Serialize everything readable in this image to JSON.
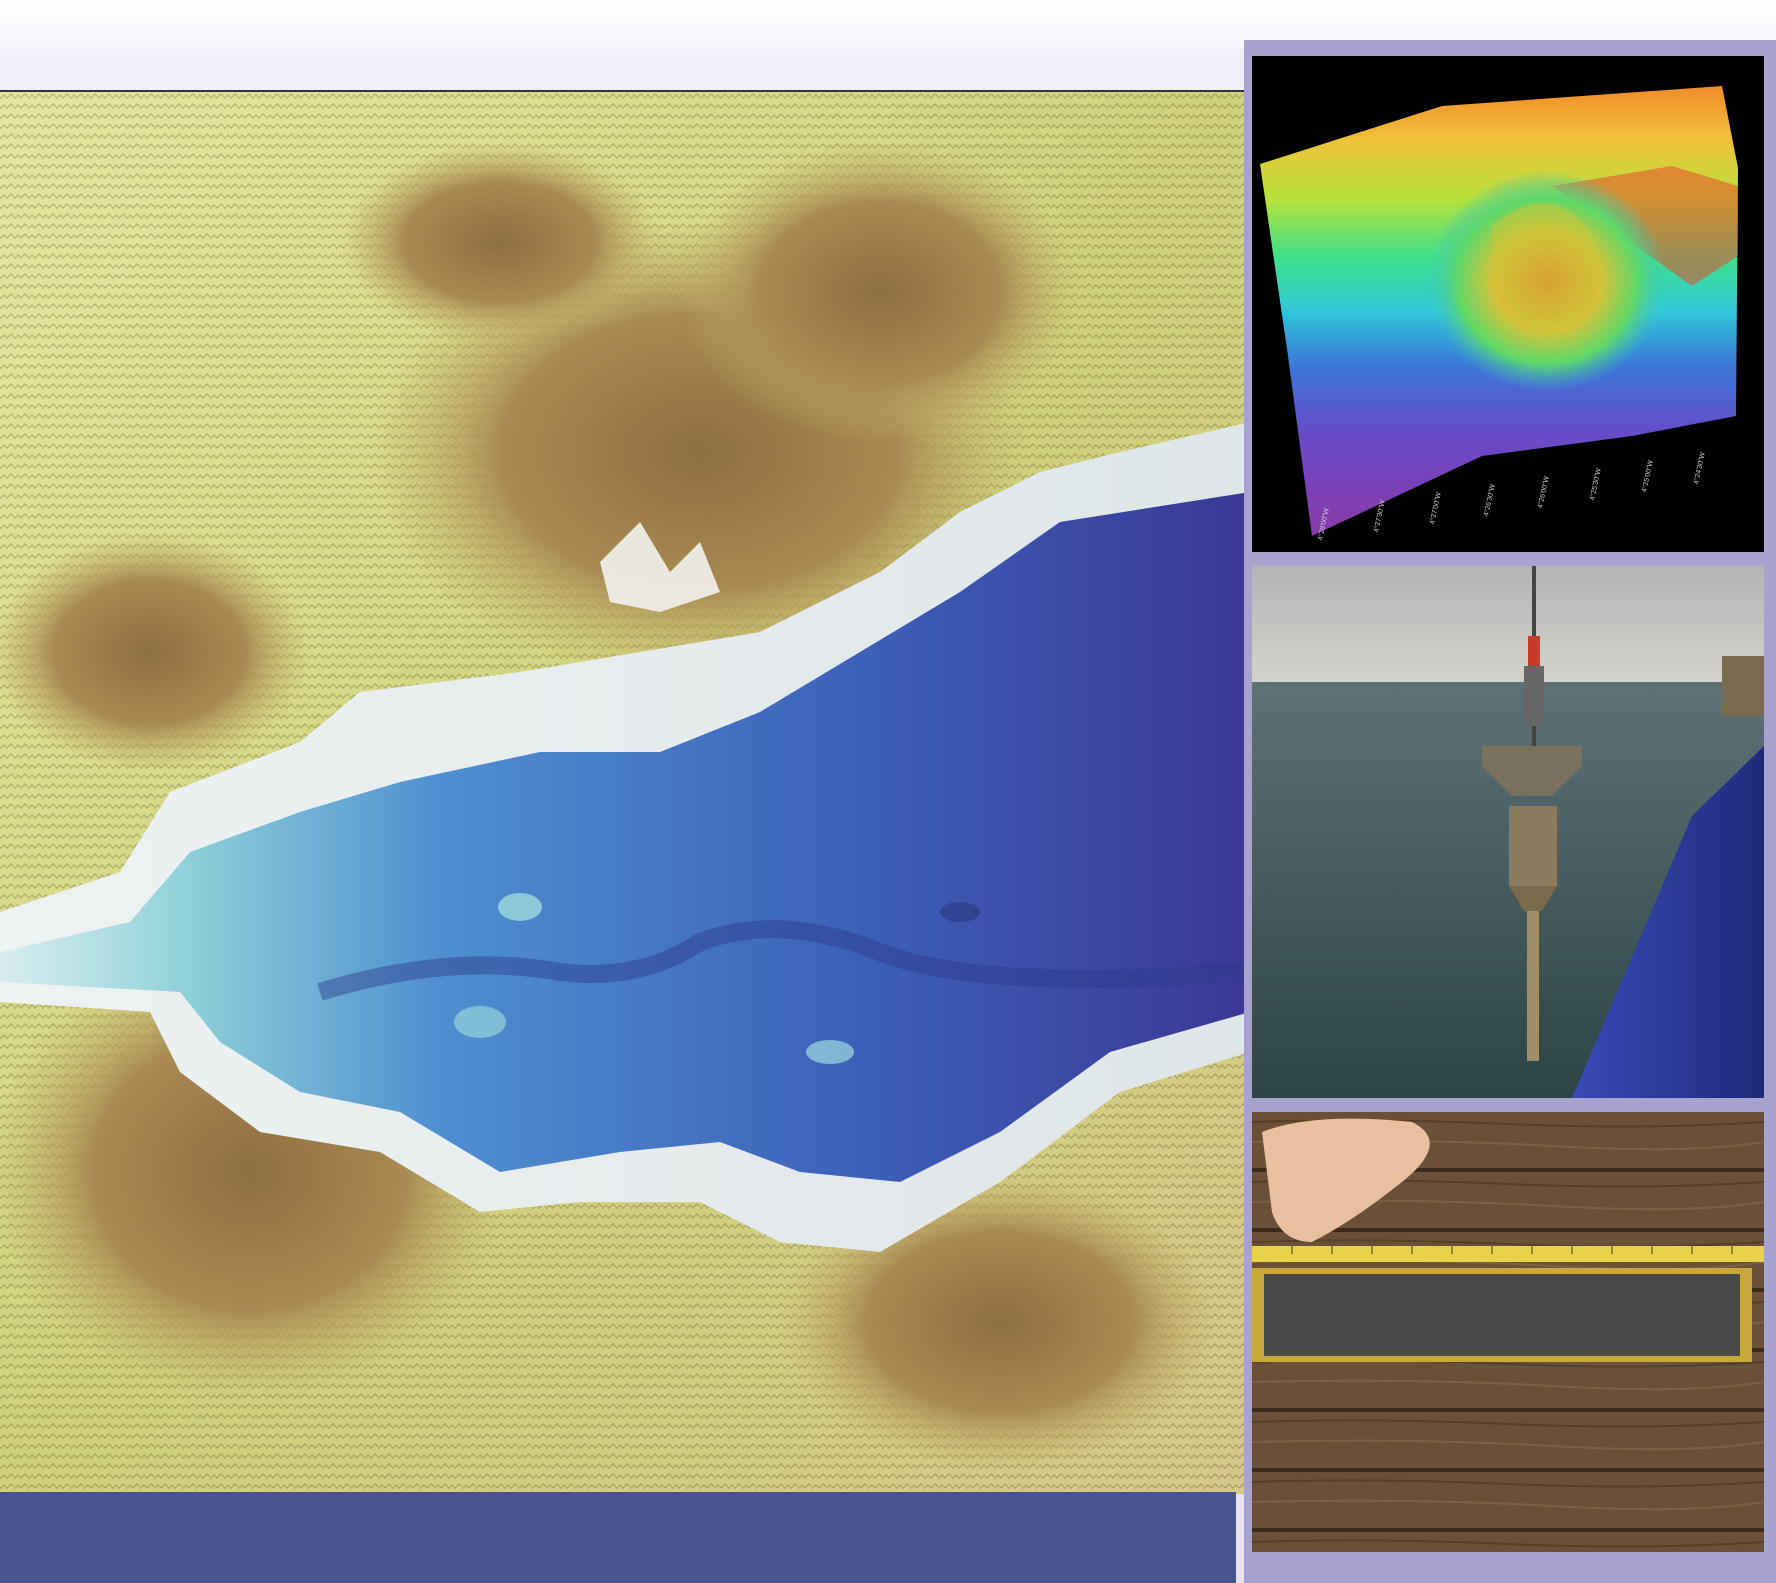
{
  "panels": {
    "main_map": {
      "subject": "shaded-relief-bathymetry-map"
    },
    "bathy_3d": {
      "subject": "3d-multibeam-bathymetry",
      "tick_labels": [
        "4°28'00\"W",
        "4°27'30\"W",
        "4°27'00\"W",
        "4°26'30\"W",
        "4°26'00\"W",
        "4°25'30\"W",
        "4°25'00\"W",
        "4°24'30\"W"
      ]
    },
    "corer_photo": {
      "subject": "gravity-corer-over-sea"
    },
    "core_photo": {
      "subject": "sediment-core-with-measuring-tape"
    }
  },
  "colors": {
    "band": "#48538f",
    "frame": "#a8a2cf",
    "land_low": "#d9dd8a",
    "land_high": "#a7864f",
    "water_shallow": "#8fd0d8",
    "water_deep": "#3d3f97"
  }
}
